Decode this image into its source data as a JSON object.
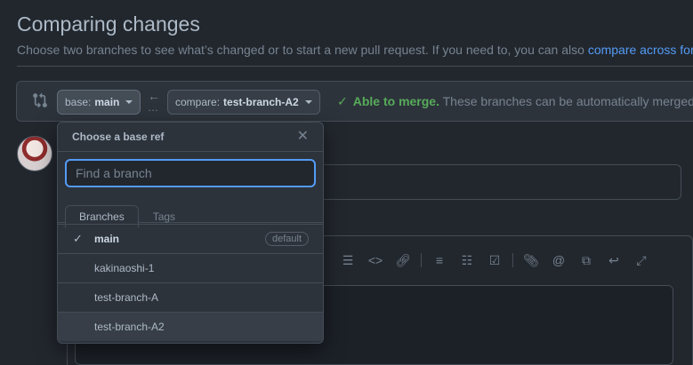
{
  "page": {
    "title": "Comparing changes",
    "subtitle": "Choose two branches to see what’s changed or to start a new pull request. If you need to, you can also ",
    "subtitle_link": "compare across forks"
  },
  "range": {
    "base_prefix": "base:",
    "base_value": "main",
    "compare_prefix": "compare:",
    "compare_value": "test-branch-A2",
    "merge_ok": "Able to merge.",
    "merge_msg": "These branches can be automatically merged."
  },
  "dropdown": {
    "title": "Choose a base ref",
    "filter_placeholder": "Find a branch",
    "tabs": [
      "Branches",
      "Tags"
    ],
    "items": [
      {
        "name": "main",
        "selected": true,
        "badge": "default"
      },
      {
        "name": "kakinaoshi-1"
      },
      {
        "name": "test-branch-A"
      },
      {
        "name": "test-branch-A2"
      }
    ]
  },
  "toolbar_icons": [
    "heading-icon",
    "code-icon",
    "link-icon",
    "ordered-list-icon",
    "unordered-list-icon",
    "task-list-icon",
    "attach-icon",
    "mention-icon",
    "reference-icon",
    "reply-icon",
    "fullscreen-icon"
  ],
  "colors": {
    "accent": "#539bf5",
    "success": "#57ab5a",
    "bg": "#22272e"
  }
}
